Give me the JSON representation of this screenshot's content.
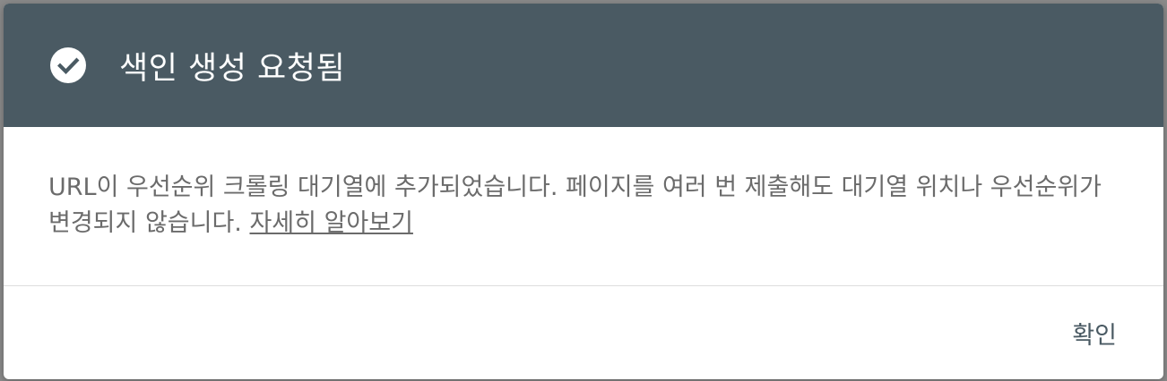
{
  "dialog": {
    "title": "색인 생성 요청됨",
    "title_icon": "check-circle-icon",
    "message": "URL이 우선순위 크롤링 대기열에 추가되었습니다. 페이지를 여러 번 제출해도 대기열 위치나 우선순위가 변경되지 않습니다. ",
    "learn_more_label": "자세히 알아보기",
    "confirm_label": "확인"
  },
  "colors": {
    "header_bg": "#4a5a63",
    "header_text": "#ffffff",
    "body_text": "#6b6b6b",
    "backdrop": "#8a8a8a"
  }
}
